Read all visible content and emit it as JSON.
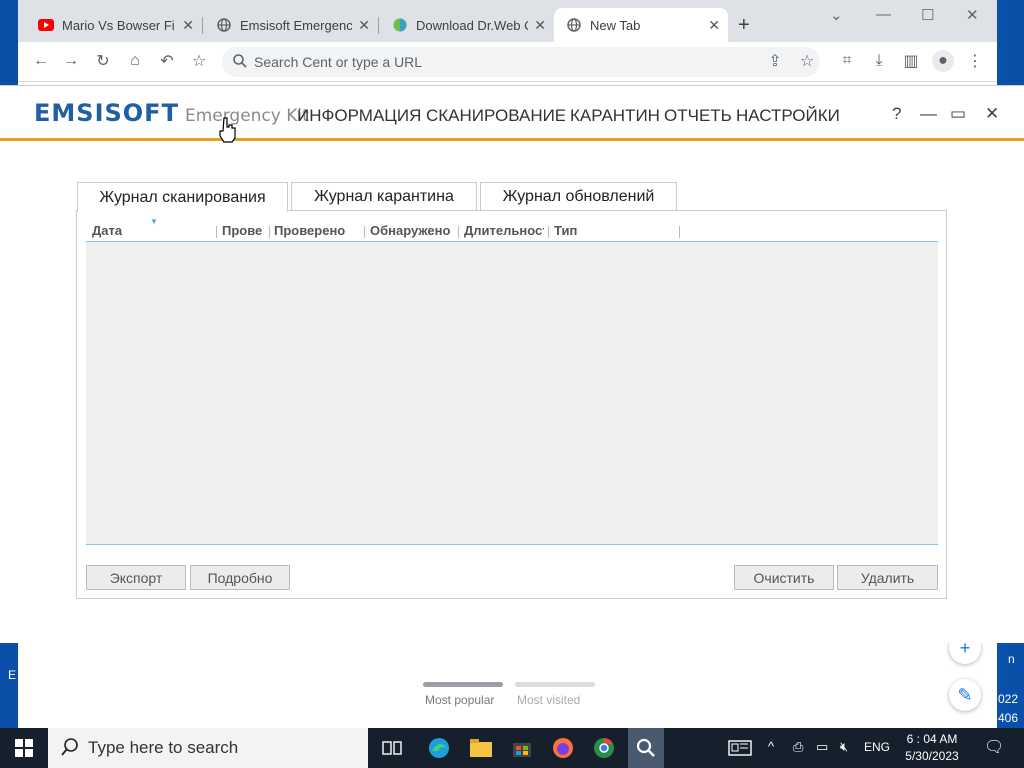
{
  "browser": {
    "tabs": [
      {
        "title": "Mario Vs Bowser Fina",
        "icon": "youtube-icon"
      },
      {
        "title": "Emsisoft Emergency",
        "icon": "globe-icon"
      },
      {
        "title": "Download Dr.Web C",
        "icon": "drweb-icon"
      },
      {
        "title": "New Tab",
        "icon": "globe-icon"
      }
    ],
    "active_tab": 3,
    "omnibox_placeholder": "Search Cent or type a URL",
    "ntp": {
      "most_popular": "Most popular",
      "most_visited": "Most visited"
    }
  },
  "emsisoft": {
    "logo_brand": "EMSISOFT",
    "logo_kit": "Emergency Kit",
    "nav": [
      "ИНФОРМАЦИЯ",
      "СКАНИРОВАНИЕ",
      "КАРАНТИН",
      "ОТЧЕТЫ",
      "НАСТРОЙКИ"
    ],
    "help": "?",
    "tabs": [
      "Журнал сканирования",
      "Журнал карантина",
      "Журнал обновлений"
    ],
    "active_tab": 0,
    "columns": [
      "Дата",
      "Проверено",
      "Проверено",
      "Обнаружено",
      "Длительность",
      "Тип"
    ],
    "buttons": {
      "export": "Экспорт",
      "details": "Подробно",
      "clear": "Очистить",
      "delete": "Удалить"
    }
  },
  "taskbar": {
    "search_placeholder": "Type here to search",
    "lang": "ENG",
    "time": "6 : 04 AM",
    "date": "5/30/2023"
  },
  "desktop_fragments": {
    "right_top": "n",
    "right_year": "022",
    "right_num": "406",
    "left": "E"
  }
}
